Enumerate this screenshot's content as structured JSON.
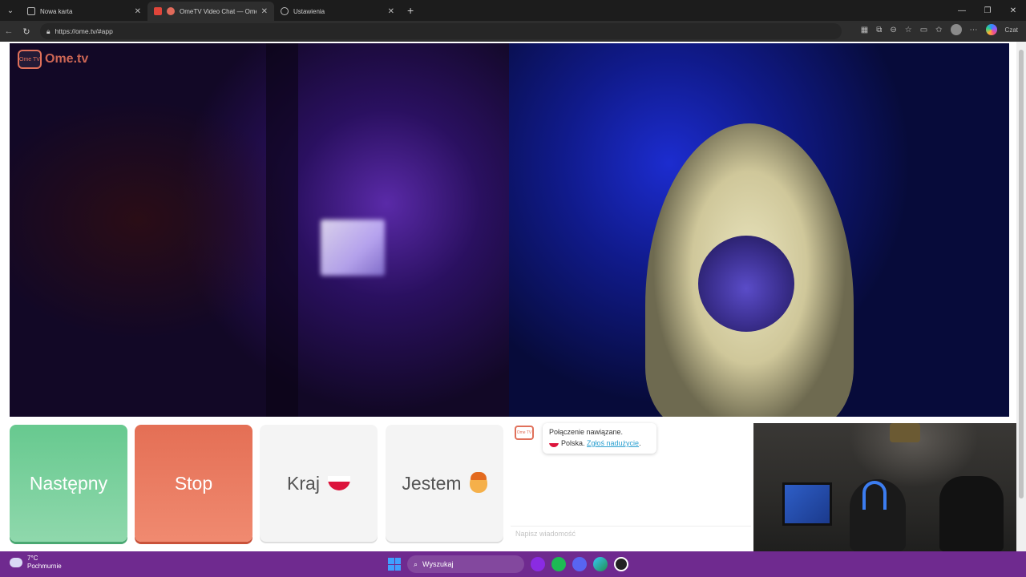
{
  "browser": {
    "tabs": [
      {
        "title": "Nowa karta",
        "active": false
      },
      {
        "title": "OmeTV Video Chat — Omegl",
        "active": true
      },
      {
        "title": "Ustawienia",
        "active": false
      }
    ],
    "url": "https://ome.tv/#app",
    "profile_label": "Czat"
  },
  "page": {
    "logo_text": "Ome.tv",
    "logo_badge": "Ome TV",
    "buttons": {
      "next_label": "Następny",
      "stop_label": "Stop",
      "country_label": "Kraj",
      "gender_label": "Jestem"
    },
    "chat": {
      "status_line": "Połączenie nawiązane.",
      "country_text": "Polska.",
      "report_link": "Zgłoś nadużycie",
      "report_suffix": ".",
      "input_placeholder": "Napisz wiadomość"
    }
  },
  "taskbar": {
    "temperature": "7°C",
    "weather": "Pochmurnie",
    "search_placeholder": "Wyszukaj"
  },
  "colors": {
    "next": "#67c98f",
    "stop": "#e46f55",
    "brand": "#e0705a",
    "taskbar": "#6f2a8f"
  }
}
